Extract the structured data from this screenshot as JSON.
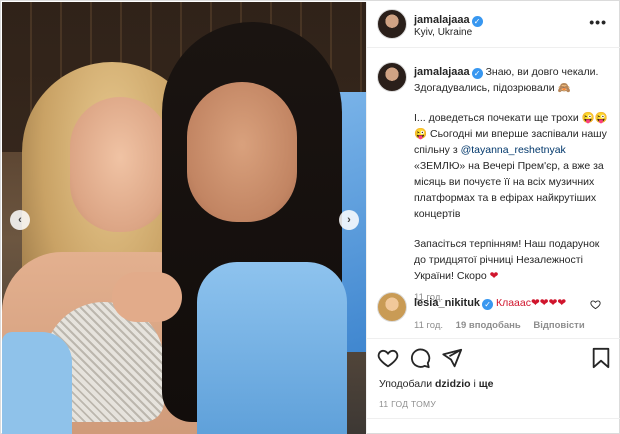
{
  "post": {
    "username": "jamalajaaa",
    "location": "Kyiv, Ukraine",
    "more_label": "•••"
  },
  "caption": {
    "username": "jamalajaaa",
    "line1": "Знаю, ви довго чекали. Здогадувались, підозрювали 🙈",
    "line2a": "І... доведеться почекати ще трохи 😜😜😜 Сьогодні ми вперше заспівали нашу спільну з ",
    "mention": "@tayanna_reshetnyak",
    "line2b": " «ЗЕМЛЮ» на Вечері Прем'єр, а вже за місяць ви почуєте її на всіх музичних платформах та в ефірах найкрутіших концертів",
    "line3": "Запасіться терпінням! Наш подарунок до тридцятої річниці Незалежності України! Скоро ",
    "heart": "❤",
    "time": "11 год."
  },
  "comment": {
    "username": "lesia_nikituk",
    "text": "Клааас❤❤❤❤",
    "time": "11 год.",
    "likes": "19 вподобань",
    "reply": "Відповісти"
  },
  "footer": {
    "likes_prefix": "Уподобали ",
    "likes_user": "dzidzio",
    "likes_and": " і ",
    "likes_more": "ще",
    "date": "11 ГОД ТОМУ"
  },
  "icons": {
    "prev": "‹",
    "next": "›",
    "heart": "heart-icon",
    "comment": "comment-icon",
    "share": "share-icon",
    "save": "bookmark-icon"
  }
}
